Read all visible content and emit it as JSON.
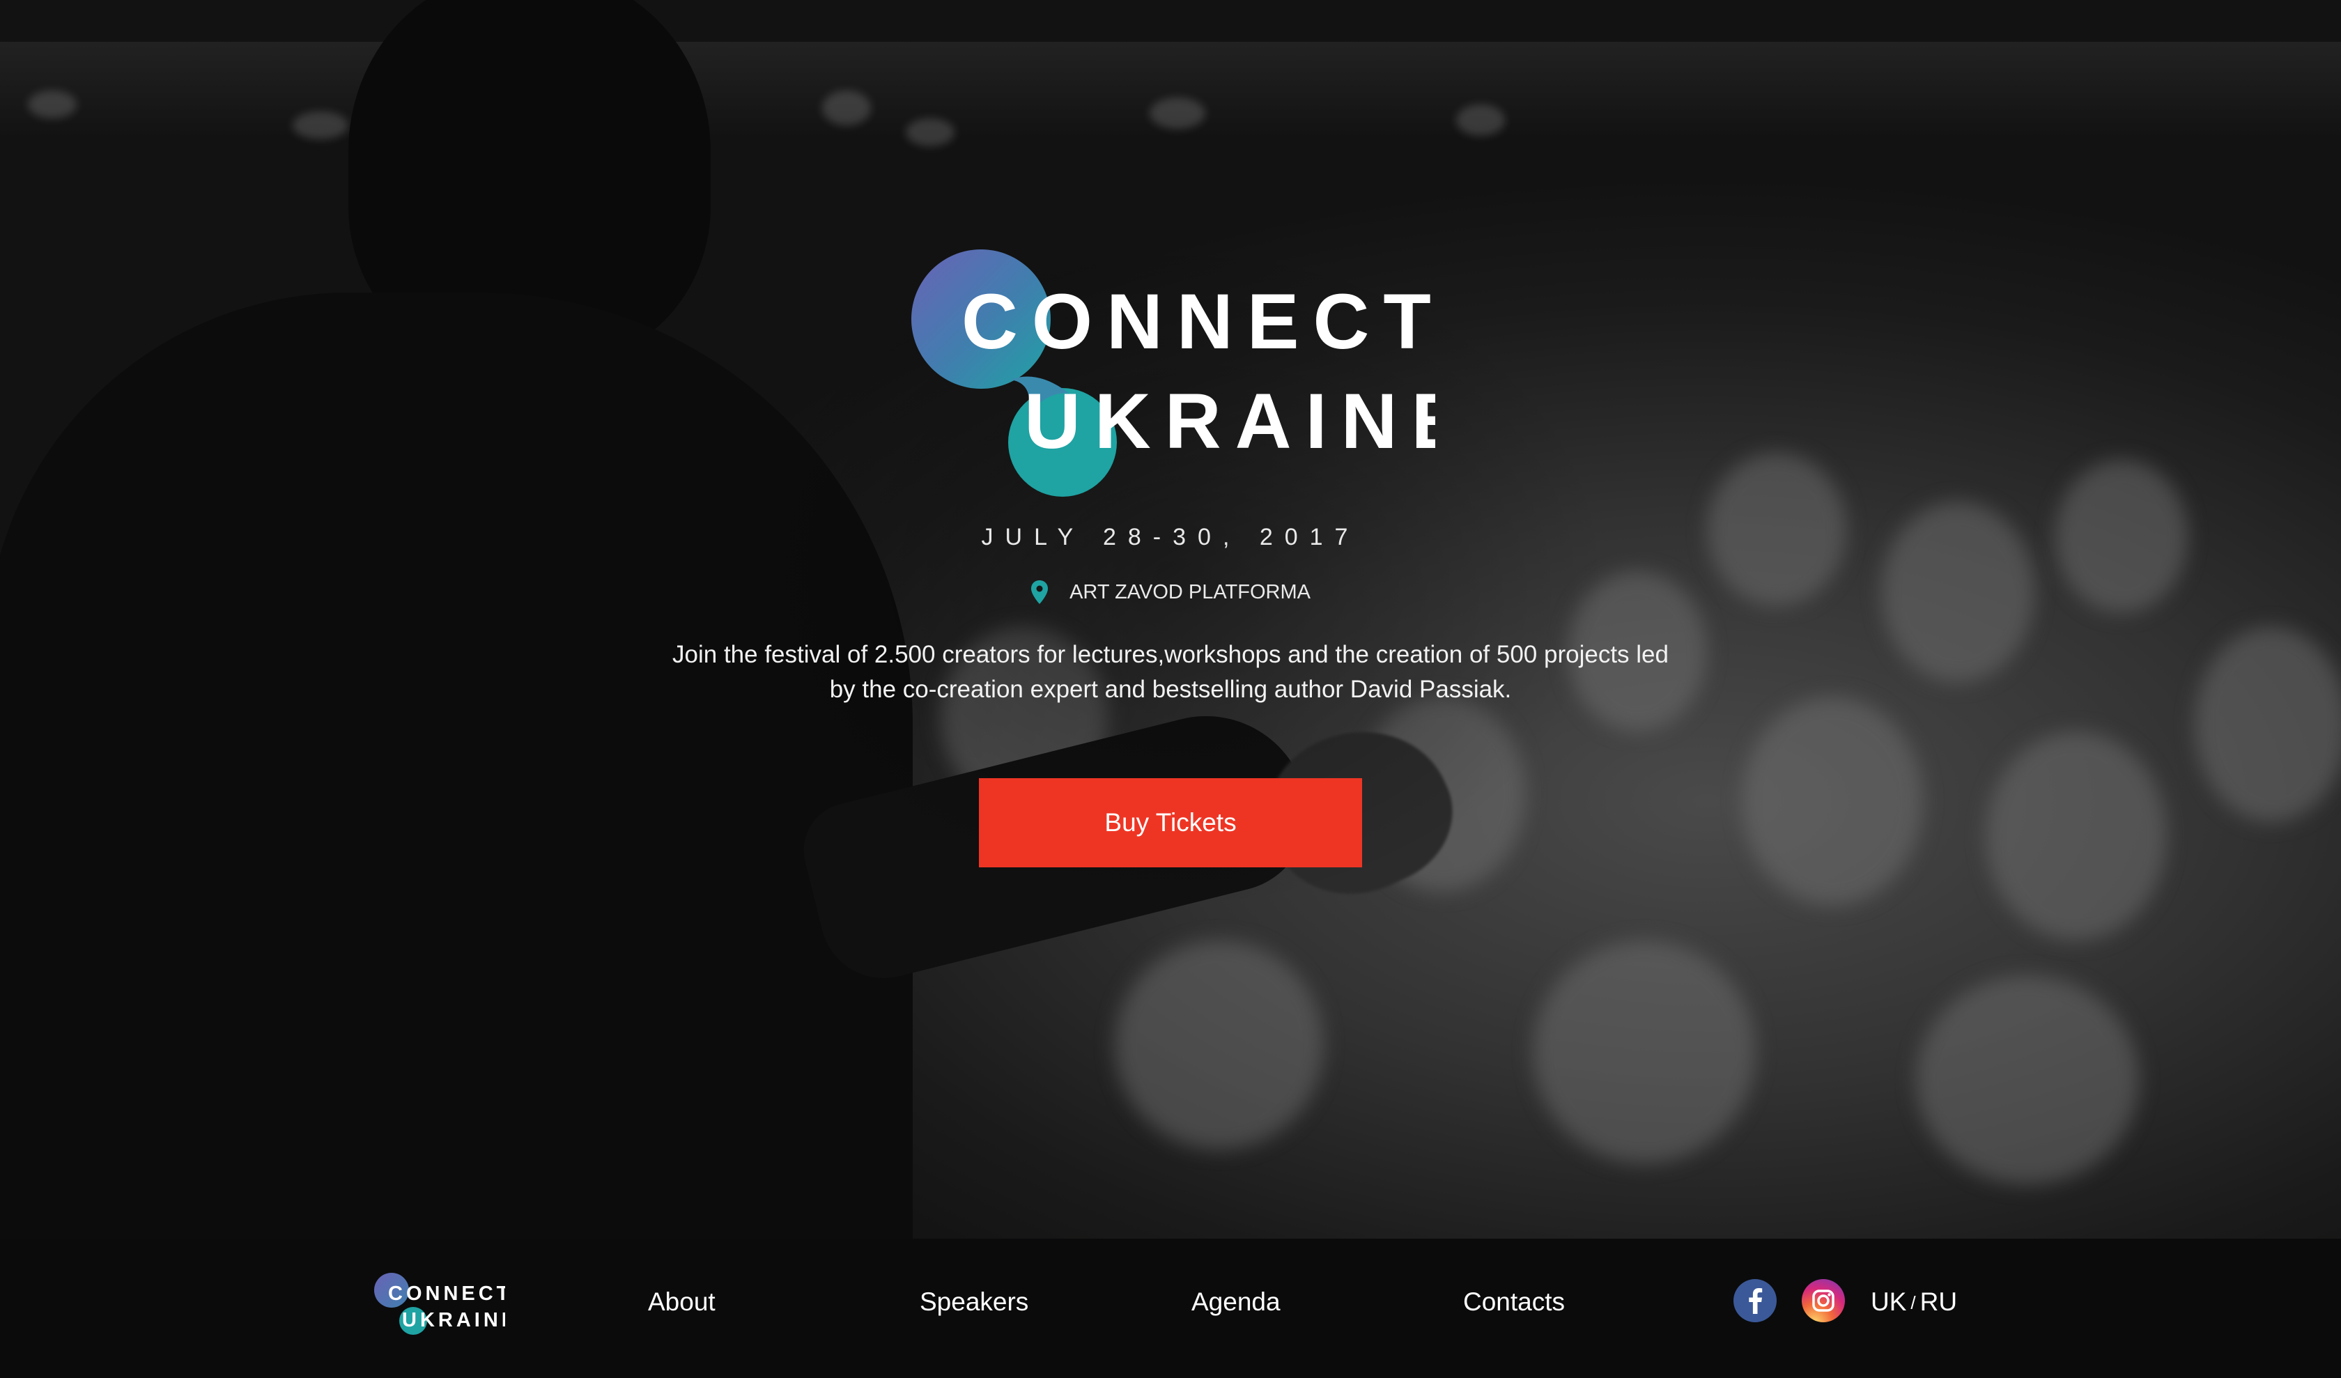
{
  "hero": {
    "logo": {
      "line1": "CONNECT",
      "line2": "UKRAINE",
      "icon": "connect-ukraine-logo"
    },
    "date": "JULY 28-30, 2017",
    "venue": {
      "icon": "map-pin-icon",
      "label": "ART ZAVOD PLATFORMA"
    },
    "description": "Join the festival of 2.500 creators for lectures,workshops and the creation of 500 projects led by the co-creation expert and bestselling author David Passiak.",
    "cta_label": "Buy Tickets"
  },
  "footer": {
    "logo": {
      "line1": "CONNECT",
      "line2": "UKRAINE"
    },
    "nav": [
      "About",
      "Speakers",
      "Agenda",
      "Contacts"
    ],
    "social": [
      {
        "icon": "facebook-icon"
      },
      {
        "icon": "instagram-icon"
      }
    ],
    "lang": {
      "primary": "UK",
      "separator": "/",
      "secondary": "RU"
    }
  },
  "colors": {
    "accent": "#ee3524",
    "logo_blue": "#5a6fb8",
    "logo_teal": "#1fa3a3",
    "footer_bg": "#0b0b0c"
  }
}
